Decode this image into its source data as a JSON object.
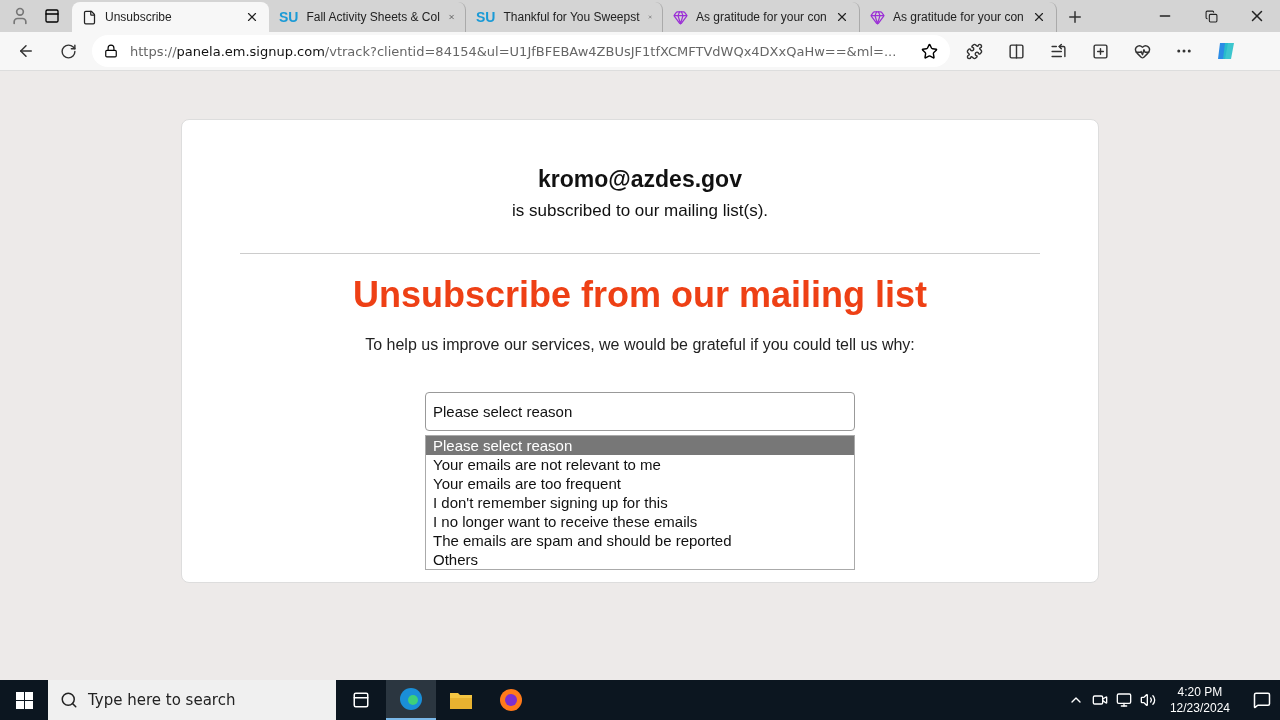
{
  "browser": {
    "tabs": [
      {
        "kind": "page",
        "title": "Unsubscribe",
        "selected": true
      },
      {
        "kind": "badge",
        "badge": "SU",
        "title": "Fall Activity Sheets & Col",
        "selected": false
      },
      {
        "kind": "badge",
        "badge": "SU",
        "title": "Thankful for You Sweepst",
        "selected": false
      },
      {
        "kind": "gem",
        "title": "As gratitude for your con",
        "selected": false
      },
      {
        "kind": "gem",
        "title": "As gratitude for your con",
        "selected": false
      }
    ],
    "address": {
      "scheme": "https://",
      "host": "panela.em.signup.com",
      "rest": "/vtrack?clientid=84154&ul=U1JfBFEBAw4ZBUsJF1tfXCMFTVdWQx4DXxQaHw==&ml=..."
    }
  },
  "page": {
    "email": "kromo@azdes.gov",
    "subscribed_text": "is subscribed to our mailing list(s).",
    "heading": "Unsubscribe from our mailing list",
    "prompt": "To help us improve our services, we would be grateful if you could tell us why:",
    "reason_select": {
      "value": "Please select reason",
      "options": [
        {
          "label": "Please select reason",
          "selected": true
        },
        {
          "label": "Your emails are not relevant to me",
          "selected": false
        },
        {
          "label": "Your emails are too frequent",
          "selected": false
        },
        {
          "label": "I don't remember signing up for this",
          "selected": false
        },
        {
          "label": "I no longer want to receive these emails",
          "selected": false
        },
        {
          "label": "The emails are spam and should be reported",
          "selected": false
        },
        {
          "label": "Others",
          "selected": false
        }
      ]
    }
  },
  "taskbar": {
    "search_placeholder": "Type here to search",
    "time": "4:20 PM",
    "date": "12/23/2024"
  }
}
